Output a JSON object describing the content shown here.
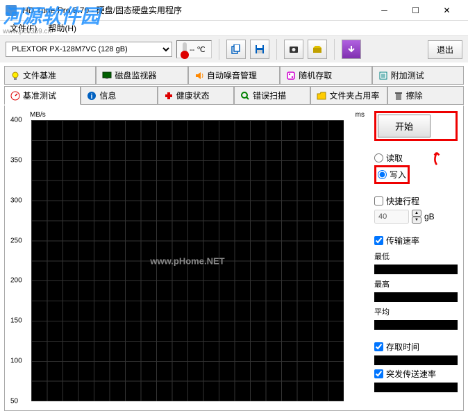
{
  "titlebar": {
    "title": "HD Tune Pro 5.70 - 硬盘/固态硬盘实用程序"
  },
  "menubar": {
    "file": "文件(F)",
    "help": "帮助(H)"
  },
  "watermark": {
    "text": "河源软件园",
    "url": "www.pc0359.cn"
  },
  "toolbar": {
    "drive": "PLEXTOR PX-128M7VC (128 gB)",
    "temp": "-- ℃",
    "exit": "退出"
  },
  "tabs_row1": [
    {
      "label": "文件基准",
      "icon_color": "#c0c000"
    },
    {
      "label": "磁盘监视器",
      "icon_color": "#008000"
    },
    {
      "label": "自动噪音管理",
      "icon_color": "#ff8800"
    },
    {
      "label": "随机存取",
      "icon_color": "#d000d0"
    },
    {
      "label": "附加测试",
      "icon_color": "#008080"
    }
  ],
  "tabs_row2": [
    {
      "label": "基准测试",
      "icon_color": "#d00000",
      "active": true
    },
    {
      "label": "信息",
      "icon_color": "#0060c0"
    },
    {
      "label": "健康状态",
      "icon_color": "#d00000"
    },
    {
      "label": "错误扫描",
      "icon_color": "#008000"
    },
    {
      "label": "文件夹占用率",
      "icon_color": "#c0a000"
    },
    {
      "label": "擦除",
      "icon_color": "#505050"
    }
  ],
  "chart": {
    "y_unit": "MB/s",
    "x_unit": "ms",
    "watermark": "www.pHome.NET"
  },
  "chart_data": {
    "type": "line",
    "ylabel": "MB/s",
    "ylim": [
      50,
      400
    ],
    "yticks": [
      400,
      350,
      300,
      250,
      200,
      150,
      100,
      50
    ],
    "xlabel": "ms",
    "series": []
  },
  "side": {
    "start": "开始",
    "read": "读取",
    "write": "写入",
    "short_stroke": "快捷行程",
    "stroke_value": "40",
    "stroke_unit": "gB",
    "transfer_rate": "传输速率",
    "min": "最低",
    "max": "最高",
    "avg": "平均",
    "access_time": "存取时间",
    "burst_rate": "突发传送速率"
  }
}
